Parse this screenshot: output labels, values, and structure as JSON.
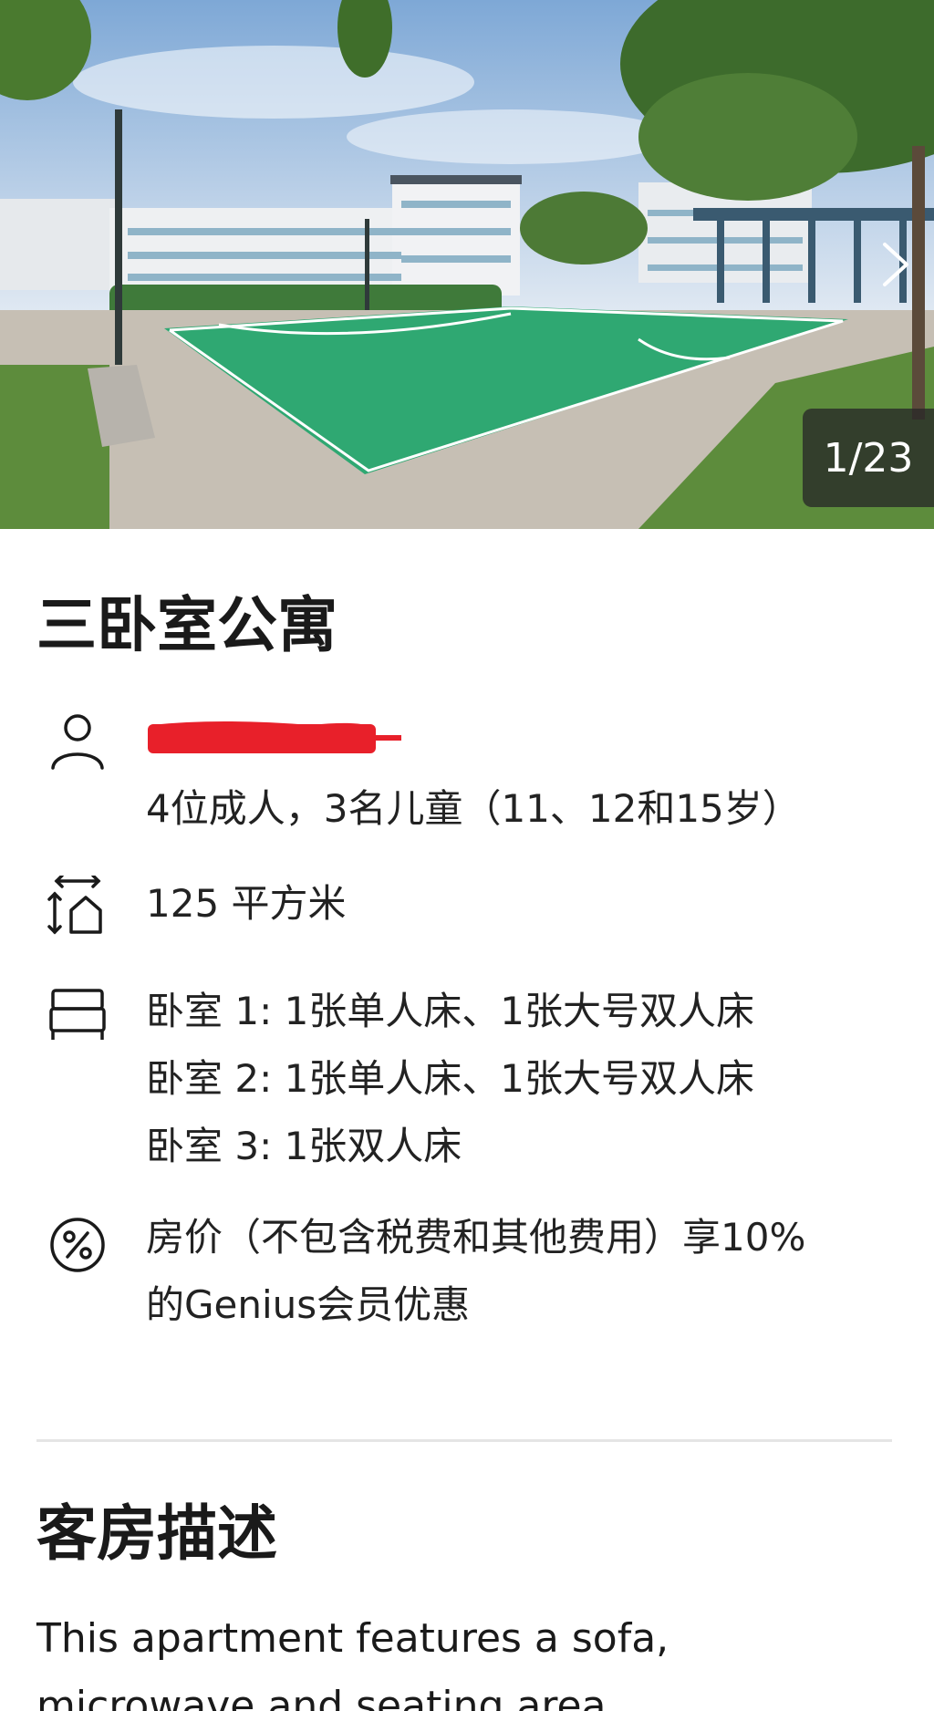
{
  "gallery": {
    "counter": "1/23",
    "next_icon": "chevron-right-icon"
  },
  "room": {
    "title": "三卧室公寓",
    "guests": "4位成人，3名儿童（11、12和15岁）",
    "size": "125 平方米",
    "beds": [
      "卧室 1: 1张单人床、1张大号双人床",
      "卧室 2: 1张单人床、1张大号双人床",
      "卧室 3: 1张双人床"
    ],
    "discount_line1": "房价（不包含税费和其他费用）享10%",
    "discount_line2": "的Genius会员优惠"
  },
  "description": {
    "heading": "客房描述",
    "text": "This apartment features a sofa, microwave and seating area."
  },
  "colors": {
    "redaction": "#e8202a",
    "court": "#2fa872",
    "icon_stroke": "#1a1a1a"
  }
}
